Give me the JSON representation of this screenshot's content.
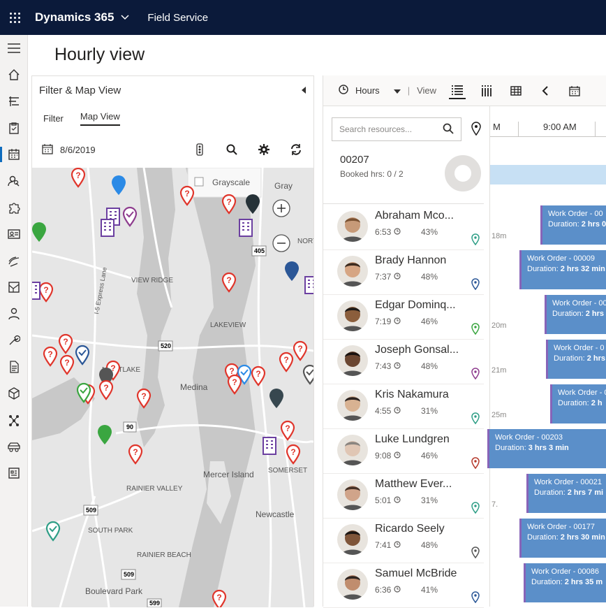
{
  "header": {
    "app_name": "Dynamics 365",
    "module": "Field Service"
  },
  "page": {
    "title": "Hourly view"
  },
  "left_panel": {
    "title": "Filter & Map View",
    "tabs": [
      "Filter",
      "Map View"
    ],
    "date": "8/6/2019",
    "map": {
      "grayscale_label": "Grayscale",
      "gray_label": "Gray",
      "places": [
        "VIEW RIDGE",
        "LAKEVIEW",
        "MONTLAKE",
        "Medina",
        "RAINIER VALLEY",
        "SOUTH PARK",
        "RAINIER BEACH",
        "Boulevard Park",
        "Mercer Island",
        "Newcastle",
        "SOMERSET",
        "NORT",
        "I-5 Express Lane"
      ],
      "roads": [
        "520",
        "405",
        "90",
        "509",
        "509",
        "599"
      ]
    }
  },
  "right_panel": {
    "toolbar": {
      "hours_label": "Hours",
      "view_label": "View"
    },
    "search_placeholder": "Search resources...",
    "summary": {
      "id": "00207",
      "booked": "Booked hrs: 0 / 2"
    },
    "timeline": {
      "times": [
        "M",
        "9:00 AM"
      ]
    },
    "resources": [
      {
        "name": "Abraham Mco...",
        "time": "6:53",
        "pct": "43%",
        "pin_color": "#2e9e86"
      },
      {
        "name": "Brady Hannon",
        "time": "7:37",
        "pct": "48%",
        "pin_color": "#2b5797"
      },
      {
        "name": "Edgar Dominq...",
        "time": "7:19",
        "pct": "46%",
        "pin_color": "#3aa640"
      },
      {
        "name": "Joseph Gonsal...",
        "time": "7:43",
        "pct": "48%",
        "pin_color": "#8e3c8e"
      },
      {
        "name": "Kris Nakamura",
        "time": "4:55",
        "pct": "31%",
        "pin_color": "#2e9e86"
      },
      {
        "name": "Luke Lundgren",
        "time": "9:08",
        "pct": "46%",
        "pin_color": "#b5382b"
      },
      {
        "name": "Matthew Ever...",
        "time": "5:01",
        "pct": "31%",
        "pin_color": "#2e9e86"
      },
      {
        "name": "Ricardo Seely",
        "time": "7:41",
        "pct": "48%",
        "pin_color": "#555555"
      },
      {
        "name": "Samuel McBride",
        "time": "6:36",
        "pct": "41%",
        "pin_color": "#2b5797"
      }
    ],
    "work_orders": [
      {
        "title": "Work Order - 00",
        "duration_label": "Duration:",
        "duration": "2 hrs 0",
        "gap": "18m"
      },
      {
        "title": "Work Order - 00009",
        "duration_label": "Duration:",
        "duration": "2 hrs 32 min",
        "gap": ""
      },
      {
        "title": "Work Order - 00",
        "duration_label": "Duration:",
        "duration": "2 hrs 5",
        "gap": "20m"
      },
      {
        "title": "Work Order - 0",
        "duration_label": "Duration:",
        "duration": "2 hrs",
        "gap": "21m"
      },
      {
        "title": "Work Order - 0",
        "duration_label": "Duration:",
        "duration": "2 h",
        "gap": "25m"
      },
      {
        "title": "Work Order - 00203",
        "duration_label": "Duration:",
        "duration": "3 hrs 3 min",
        "gap": ""
      },
      {
        "title": "Work Order - 00021",
        "duration_label": "Duration:",
        "duration": "2 hrs 7 mi",
        "gap": "7."
      },
      {
        "title": "Work Order - 00177",
        "duration_label": "Duration:",
        "duration": "2 hrs 30 min",
        "gap": ""
      },
      {
        "title": "Work Order - 00086",
        "duration_label": "Duration:",
        "duration": "2 hrs 35 m",
        "gap": ""
      }
    ]
  },
  "colors": {
    "topbar": "#0b1a3a",
    "accent": "#0f6cbd",
    "work_order": "#5b8fc9",
    "pin_red": "#e0352b"
  }
}
